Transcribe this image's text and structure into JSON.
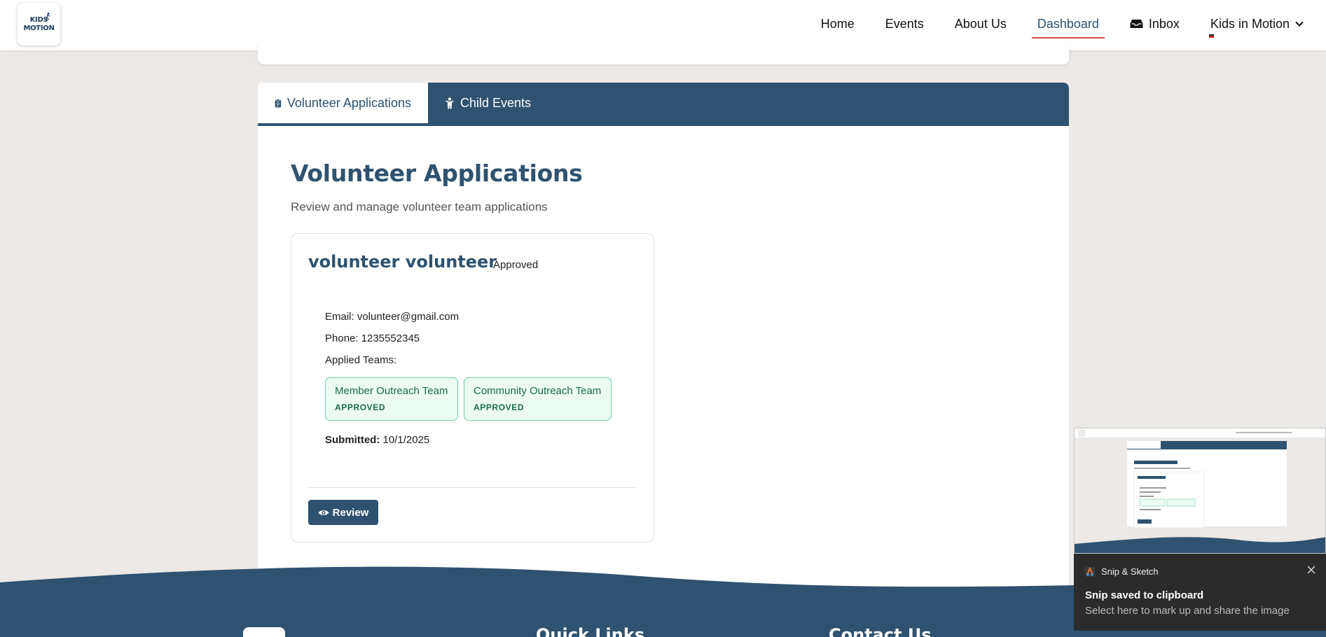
{
  "navbar": {
    "logo_line1": "KIDS",
    "logo_line2": "MOTION",
    "links": [
      "Home",
      "Events",
      "About Us",
      "Dashboard"
    ],
    "active_link": "Dashboard",
    "inbox_label": "Inbox",
    "org_dropdown_label": "Kids in Motion"
  },
  "tabs": [
    {
      "label": "Volunteer Applications",
      "icon": "clipboard-icon",
      "active": true
    },
    {
      "label": "Child Events",
      "icon": "child-icon",
      "active": false
    }
  ],
  "main": {
    "title": "Volunteer Applications",
    "subtitle": "Review and manage volunteer team applications"
  },
  "application": {
    "name": "volunteer volunteer",
    "status": "Approved",
    "email_line": "Email: volunteer@gmail.com",
    "phone_line": "Phone: 1235552345",
    "teams_label": "Applied Teams:",
    "teams": [
      {
        "name": "Member Outreach Team",
        "status": "APPROVED"
      },
      {
        "name": "Community Outreach Team",
        "status": "APPROVED"
      }
    ],
    "submitted_label": "Submitted:",
    "submitted_date": "10/1/2025",
    "review_label": "Review"
  },
  "footer": {
    "headings": [
      "Quick Links",
      "Contact Us"
    ]
  },
  "notification": {
    "app_name": "Snip & Sketch",
    "title": "Snip saved to clipboard",
    "message": "Select here to mark up and share the image"
  },
  "colors": {
    "primary": "#2f5270",
    "accent_underline": "#d9443a",
    "approved_chip_bg": "#ecfbf3",
    "approved_chip_border": "#6fd3a4",
    "page_bg": "#ece9e6"
  }
}
